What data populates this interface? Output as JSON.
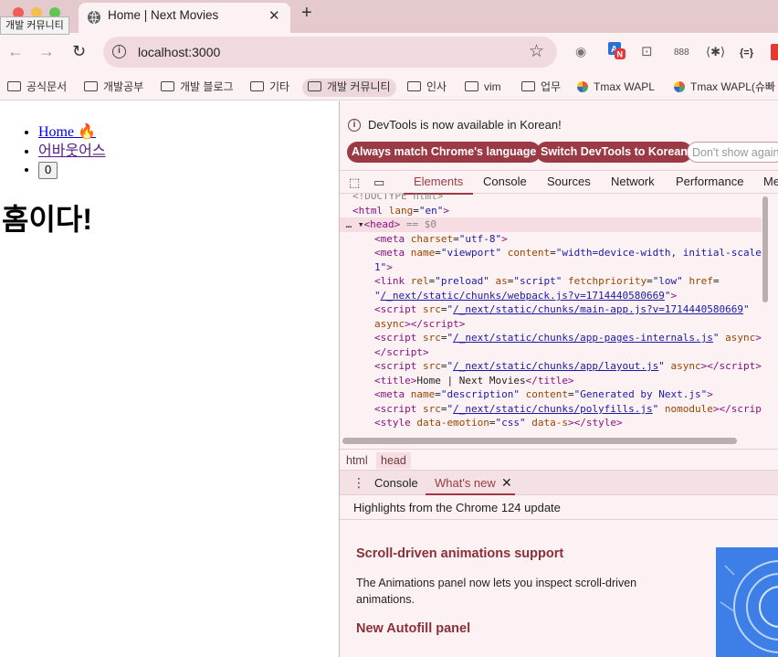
{
  "tooltip": "개발 커뮤니티",
  "browser": {
    "tab_title": "Home | Next Movies",
    "new_tab": "+",
    "url": "localhost:3000",
    "extensions": [
      "ext-github-icon",
      "ext-translate-icon",
      "ext-camera-icon",
      "ext-888-icon",
      "ext-network-icon",
      "ext-json-icon"
    ],
    "ext_badge": "N",
    "ext_888_label": "888",
    "ext_json_label": "{=}"
  },
  "bookmarks": [
    {
      "label": "공식문서",
      "type": "folder"
    },
    {
      "label": "개발공부",
      "type": "folder"
    },
    {
      "label": "개발 블로그",
      "type": "folder"
    },
    {
      "label": "기타",
      "type": "folder"
    },
    {
      "label": "개발 커뮤니티",
      "type": "folder",
      "active": true
    },
    {
      "label": "인사",
      "type": "folder"
    },
    {
      "label": "vim",
      "type": "folder"
    },
    {
      "label": "업무",
      "type": "folder"
    },
    {
      "label": "Tmax WAPL",
      "type": "site"
    },
    {
      "label": "Tmax WAPL(슈빠",
      "type": "site"
    }
  ],
  "page": {
    "nav": {
      "home": "Home 🔥",
      "about": "어바웃어스",
      "counter": "0"
    },
    "heading": "홈이다!"
  },
  "devtools": {
    "banner_message": "DevTools is now available in Korean!",
    "btn_match": "Always match Chrome's language",
    "btn_switch": "Switch DevTools to Korean",
    "btn_dont_show": "Don't show again",
    "tabs": [
      "Elements",
      "Console",
      "Sources",
      "Network",
      "Performance",
      "Me"
    ],
    "active_tab": "Elements",
    "selected_marker": "== $0",
    "breadcrumbs": [
      "html",
      "head"
    ],
    "drawer_tabs": [
      "Console",
      "What's new"
    ],
    "drawer_active": "What's new",
    "highlights": "Highlights from the Chrome 124 update",
    "whats_new": [
      {
        "title": "Scroll-driven animations support",
        "body": "The Animations panel now lets you inspect scroll-driven animations."
      },
      {
        "title": "New Autofill panel",
        "body": ""
      }
    ]
  }
}
